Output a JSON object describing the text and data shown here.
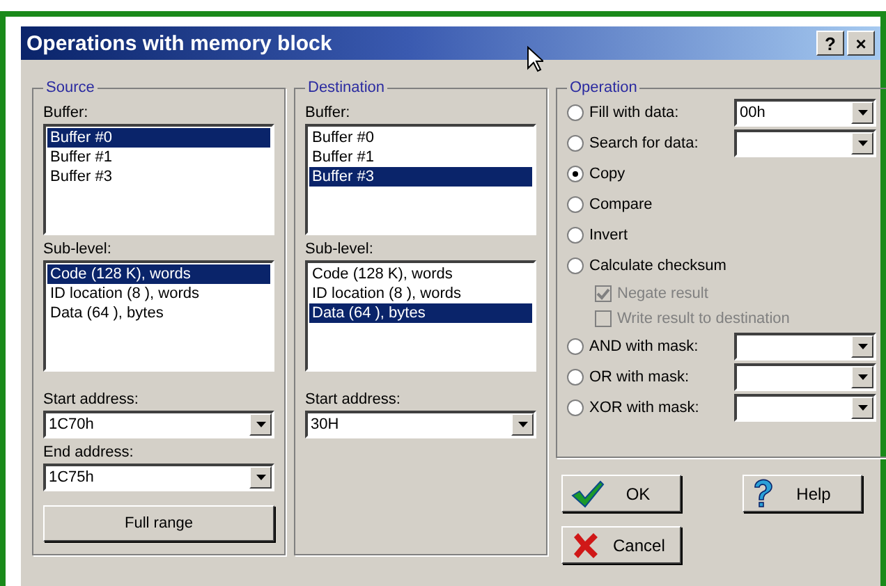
{
  "window": {
    "title": "Operations with memory block",
    "title_buttons": [
      "?",
      "×"
    ]
  },
  "source": {
    "legend": "Source",
    "buffer_label": "Buffer:",
    "buffers": [
      {
        "label": "Buffer #0",
        "selected": true
      },
      {
        "label": "Buffer #1",
        "selected": false
      },
      {
        "label": "Buffer #3",
        "selected": false
      }
    ],
    "sublevel_label": "Sub-level:",
    "sublevels": [
      {
        "label": "Code (128 K), words",
        "selected": true
      },
      {
        "label": "ID location (8 ), words",
        "selected": false
      },
      {
        "label": "Data (64 ), bytes",
        "selected": false
      }
    ],
    "addresses": [
      {
        "label": "Start address:",
        "value": "1C70h"
      },
      {
        "label": "End address:",
        "value": "1C75h"
      }
    ],
    "full_range_button": "Full range"
  },
  "destination": {
    "legend": "Destination",
    "buffer_label": "Buffer:",
    "buffers": [
      {
        "label": "Buffer #0",
        "selected": false
      },
      {
        "label": "Buffer #1",
        "selected": false
      },
      {
        "label": "Buffer #3",
        "selected": true
      }
    ],
    "sublevel_label": "Sub-level:",
    "sublevels": [
      {
        "label": "Code (128 K), words",
        "selected": false
      },
      {
        "label": "ID location (8 ), words",
        "selected": false
      },
      {
        "label": "Data (64 ), bytes",
        "selected": true
      }
    ],
    "addresses": [
      {
        "label": "Start address:",
        "value": "30H"
      }
    ]
  },
  "operation": {
    "legend": "Operation",
    "options": [
      {
        "kind": "radio_combo",
        "label": "Fill with data:",
        "selected": false,
        "value": "00h"
      },
      {
        "kind": "radio_combo",
        "label": "Search for data:",
        "selected": false
      },
      {
        "kind": "radio",
        "label": "Copy",
        "selected": true
      },
      {
        "kind": "radio",
        "label": "Compare",
        "selected": false
      },
      {
        "kind": "radio",
        "label": "Invert",
        "selected": false
      },
      {
        "kind": "radio",
        "label": "Calculate checksum",
        "selected": false
      },
      {
        "kind": "checkbox",
        "label": "Negate result",
        "checked": true,
        "disabled": true
      },
      {
        "kind": "checkbox",
        "label": "Write result to destination",
        "checked": false,
        "disabled": true
      },
      {
        "kind": "radio_combo",
        "label": "AND with mask:",
        "selected": false
      },
      {
        "kind": "radio_combo",
        "label": "OR with mask:",
        "selected": false
      },
      {
        "kind": "radio_combo",
        "label": "XOR with mask:",
        "selected": false
      }
    ]
  },
  "buttons": [
    {
      "kind": "ok",
      "label": "OK"
    },
    {
      "kind": "help",
      "label": "Help"
    },
    {
      "kind": "cancel",
      "label": "Cancel"
    }
  ]
}
